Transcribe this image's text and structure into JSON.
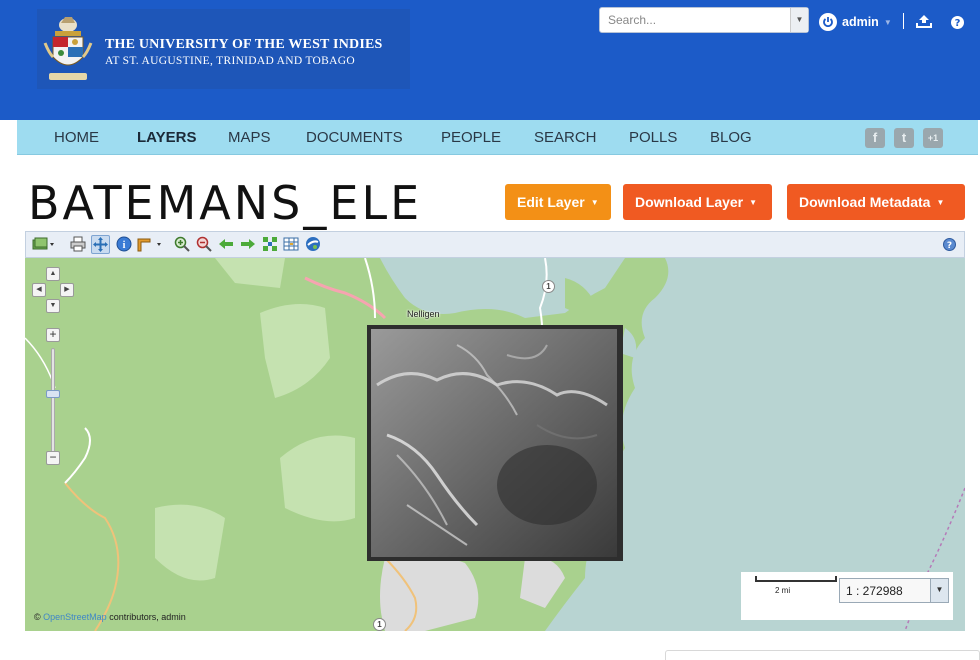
{
  "header": {
    "university_line1": "THE UNIVERSITY OF THE WEST INDIES",
    "university_line2": "AT ST. AUGUSTINE, TRINIDAD AND TOBAGO",
    "search_placeholder": "Search...",
    "user_name": "admin",
    "brand_color": "#1c5bc8"
  },
  "nav": {
    "items": [
      "HOME",
      "LAYERS",
      "MAPS",
      "DOCUMENTS",
      "PEOPLE",
      "SEARCH",
      "POLLS",
      "BLOG"
    ],
    "active": "LAYERS",
    "social": [
      "f",
      "t",
      "+1"
    ]
  },
  "page": {
    "title": "BATEMANS_ELE"
  },
  "buttons": {
    "edit_layer": "Edit Layer",
    "download_layer": "Download Layer",
    "download_metadata": "Download Metadata"
  },
  "map": {
    "town_label": "Nelligen",
    "road_shield": "1",
    "attribution_prefix": "©",
    "attribution_link": "OpenStreetMap",
    "attribution_suffix": "contributors, admin",
    "scale_label": "2 mi",
    "scale_value": "1 : 272988"
  }
}
